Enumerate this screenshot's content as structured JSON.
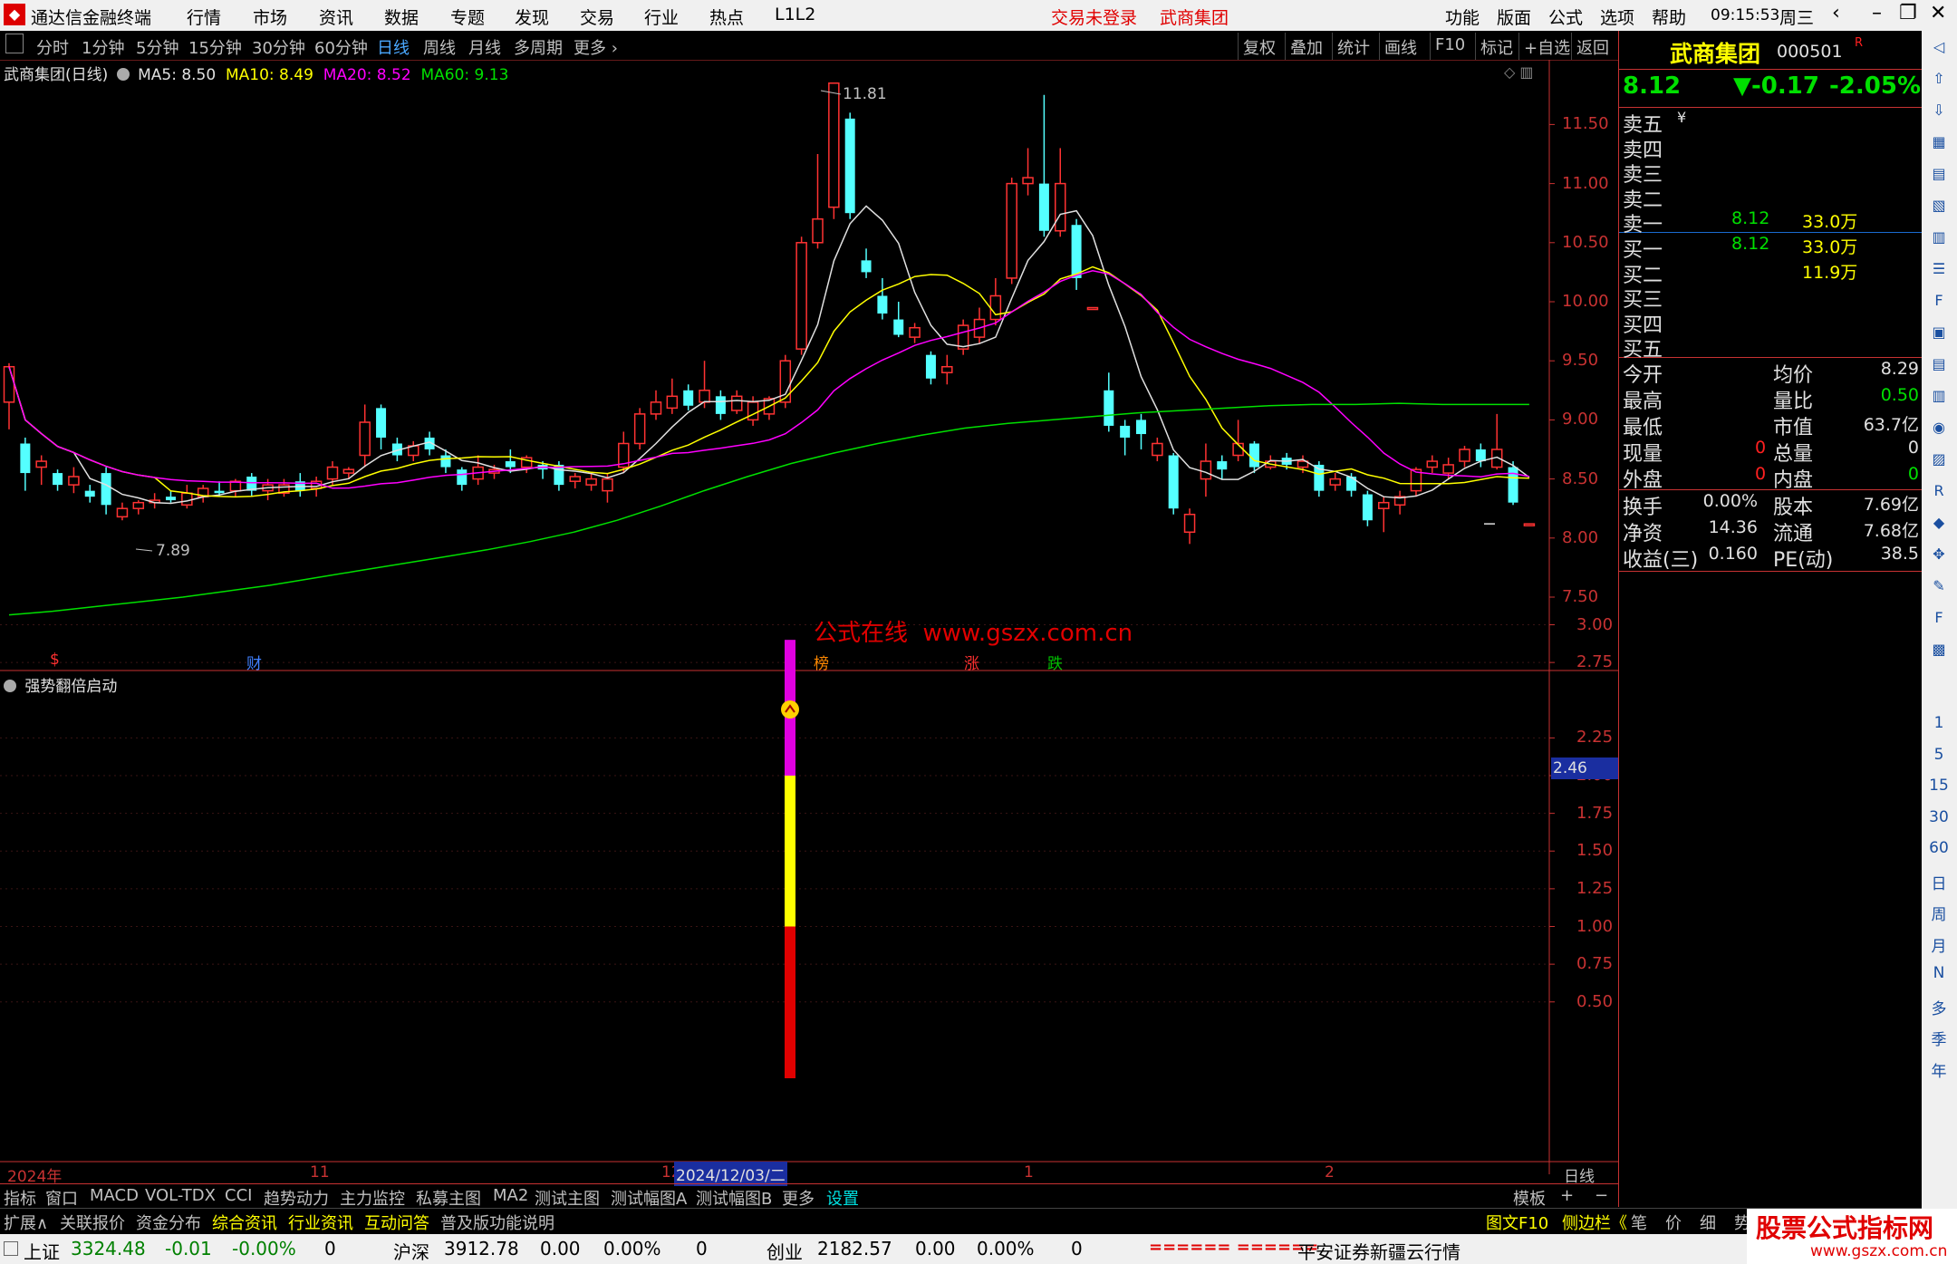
{
  "app": {
    "title": "通达信金融终端",
    "menus": [
      "行情",
      "市场",
      "资讯",
      "数据",
      "专题",
      "发现",
      "交易",
      "行业",
      "热点",
      "L1L2"
    ],
    "login_status": "交易未登录",
    "stock_name_top": "武商集团",
    "right_menus": [
      "功能",
      "版面",
      "公式",
      "选项",
      "帮助"
    ],
    "time": "09:15:53",
    "weekday": "周三"
  },
  "toolbar": {
    "periods": [
      "分时",
      "1分钟",
      "5分钟",
      "15分钟",
      "30分钟",
      "60分钟",
      "日线",
      "周线",
      "月线",
      "多周期",
      "更多 ›"
    ],
    "active_period": "日线",
    "actions": [
      "复权",
      "叠加",
      "统计",
      "画线",
      "F10",
      "标记",
      "+自选",
      "返回"
    ]
  },
  "main_chart": {
    "title": "武商集团(日线)",
    "ma": [
      {
        "label": "MA5: 8.50",
        "color": "#e0e0e0"
      },
      {
        "label": "MA10: 8.49",
        "color": "#ffff00"
      },
      {
        "label": "MA20: 8.52",
        "color": "#ff00ff"
      },
      {
        "label": "MA60: 9.13",
        "color": "#00e000"
      }
    ],
    "price_ticks": [
      "11.50",
      "11.00",
      "10.50",
      "10.00",
      "9.50",
      "9.00",
      "8.50",
      "8.00",
      "7.50"
    ],
    "high_label": "11.81",
    "low_label": "7.89",
    "watermark": "公式在线  www.gszx.com.cn",
    "event_markers": [
      {
        "text": "$",
        "color": "#ff3030"
      },
      {
        "text": "财",
        "color": "#4080ff"
      },
      {
        "text": "榜",
        "color": "#ff8800"
      },
      {
        "text": "涨",
        "color": "#ff3030"
      },
      {
        "text": "跌",
        "color": "#00c000"
      }
    ],
    "last_dash": "—"
  },
  "sub_chart": {
    "title": "强势翻倍启动",
    "ticks": [
      "3.00",
      "2.75",
      "2.25",
      "2.00",
      "1.75",
      "1.50",
      "1.25",
      "1.00",
      "0.75",
      "0.50"
    ],
    "current_value": "2.46",
    "bar": {
      "segments": [
        {
          "from": 0,
          "to": 1.0,
          "color": "#e00000"
        },
        {
          "from": 1.0,
          "to": 2.0,
          "color": "#ffff00"
        },
        {
          "from": 2.0,
          "to": 2.9,
          "color": "#e000e0"
        }
      ]
    }
  },
  "time_axis": {
    "labels": [
      "2024年",
      "11",
      "12",
      "2024/12/03/二",
      "1",
      "2"
    ],
    "right": "日线"
  },
  "chart_data": {
    "type": "candlestick",
    "ylim": [
      7.1,
      11.95
    ],
    "candles": [
      [
        9.15,
        9.45,
        9.48,
        8.92
      ],
      [
        8.8,
        8.55,
        8.85,
        8.4
      ],
      [
        8.6,
        8.65,
        8.7,
        8.45
      ],
      [
        8.55,
        8.45,
        8.58,
        8.4
      ],
      [
        8.45,
        8.52,
        8.6,
        8.38
      ],
      [
        8.4,
        8.35,
        8.45,
        8.3
      ],
      [
        8.55,
        8.28,
        8.6,
        8.2
      ],
      [
        8.18,
        8.25,
        8.3,
        8.15
      ],
      [
        8.25,
        8.3,
        8.32,
        8.2
      ],
      [
        8.3,
        8.32,
        8.38,
        8.25
      ],
      [
        8.35,
        8.32,
        8.4,
        8.3
      ],
      [
        8.28,
        8.38,
        8.45,
        8.25
      ],
      [
        8.35,
        8.42,
        8.45,
        8.3
      ],
      [
        8.4,
        8.38,
        8.48,
        8.35
      ],
      [
        8.4,
        8.48,
        8.5,
        8.35
      ],
      [
        8.52,
        8.4,
        8.55,
        8.35
      ],
      [
        8.4,
        8.45,
        8.5,
        8.32
      ],
      [
        8.38,
        8.45,
        8.5,
        8.35
      ],
      [
        8.48,
        8.4,
        8.55,
        8.35
      ],
      [
        8.42,
        8.48,
        8.52,
        8.35
      ],
      [
        8.5,
        8.6,
        8.65,
        8.45
      ],
      [
        8.55,
        8.58,
        8.6,
        8.5
      ],
      [
        8.7,
        8.98,
        9.13,
        8.6
      ],
      [
        9.1,
        8.85,
        9.13,
        8.75
      ],
      [
        8.8,
        8.7,
        8.85,
        8.65
      ],
      [
        8.7,
        8.78,
        8.82,
        8.65
      ],
      [
        8.85,
        8.75,
        8.9,
        8.7
      ],
      [
        8.7,
        8.6,
        8.75,
        8.55
      ],
      [
        8.58,
        8.45,
        8.6,
        8.4
      ],
      [
        8.5,
        8.6,
        8.7,
        8.45
      ],
      [
        8.55,
        8.58,
        8.62,
        8.5
      ],
      [
        8.65,
        8.6,
        8.75,
        8.55
      ],
      [
        8.6,
        8.68,
        8.7,
        8.55
      ],
      [
        8.62,
        8.58,
        8.65,
        8.5
      ],
      [
        8.62,
        8.45,
        8.65,
        8.4
      ],
      [
        8.48,
        8.52,
        8.55,
        8.42
      ],
      [
        8.45,
        8.5,
        8.55,
        8.4
      ],
      [
        8.4,
        8.5,
        8.55,
        8.3
      ],
      [
        8.6,
        8.8,
        8.9,
        8.55
      ],
      [
        8.8,
        9.05,
        9.1,
        8.75
      ],
      [
        9.05,
        9.15,
        9.25,
        9.0
      ],
      [
        9.1,
        9.2,
        9.35,
        9.05
      ],
      [
        9.25,
        9.12,
        9.3,
        9.08
      ],
      [
        9.15,
        9.25,
        9.5,
        9.1
      ],
      [
        9.2,
        9.05,
        9.25,
        9.0
      ],
      [
        9.08,
        9.2,
        9.25,
        9.05
      ],
      [
        9.0,
        9.15,
        9.2,
        8.95
      ],
      [
        9.05,
        9.18,
        9.2,
        9.0
      ],
      [
        9.15,
        9.5,
        9.55,
        9.1
      ],
      [
        9.6,
        10.5,
        10.55,
        9.55
      ],
      [
        10.5,
        10.7,
        11.25,
        10.45
      ],
      [
        10.8,
        11.85,
        11.85,
        10.7
      ],
      [
        11.55,
        10.75,
        11.6,
        10.7
      ],
      [
        10.35,
        10.25,
        10.45,
        10.2
      ],
      [
        10.05,
        9.9,
        10.2,
        9.85
      ],
      [
        9.85,
        9.72,
        10.0,
        9.7
      ],
      [
        9.7,
        9.78,
        9.82,
        9.65
      ],
      [
        9.55,
        9.35,
        9.58,
        9.3
      ],
      [
        9.4,
        9.45,
        9.55,
        9.3
      ],
      [
        9.6,
        9.8,
        9.85,
        9.55
      ],
      [
        9.7,
        9.85,
        9.95,
        9.65
      ],
      [
        9.85,
        10.05,
        10.2,
        9.8
      ],
      [
        10.2,
        11.0,
        11.05,
        10.15
      ],
      [
        11.0,
        11.05,
        11.3,
        10.9
      ],
      [
        11.0,
        10.6,
        11.75,
        10.55
      ],
      [
        10.6,
        11.0,
        11.3,
        10.55
      ],
      [
        10.65,
        10.2,
        10.7,
        10.1
      ],
      [
        9.95,
        9.95,
        9.95,
        9.95
      ],
      [
        9.25,
        8.95,
        9.4,
        8.9
      ],
      [
        8.95,
        8.85,
        9.0,
        8.7
      ],
      [
        9.0,
        8.88,
        9.05,
        8.75
      ],
      [
        8.7,
        8.8,
        8.85,
        8.65
      ],
      [
        8.7,
        8.25,
        8.72,
        8.2
      ],
      [
        8.05,
        8.2,
        8.25,
        7.95
      ],
      [
        8.5,
        8.65,
        8.8,
        8.35
      ],
      [
        8.65,
        8.58,
        8.7,
        8.5
      ],
      [
        8.7,
        8.8,
        9.0,
        8.65
      ],
      [
        8.8,
        8.6,
        8.82,
        8.55
      ],
      [
        8.6,
        8.65,
        8.7,
        8.58
      ],
      [
        8.68,
        8.62,
        8.72,
        8.58
      ],
      [
        8.6,
        8.65,
        8.7,
        8.55
      ],
      [
        8.62,
        8.4,
        8.65,
        8.35
      ],
      [
        8.45,
        8.5,
        8.55,
        8.4
      ],
      [
        8.52,
        8.4,
        8.55,
        8.35
      ],
      [
        8.37,
        8.15,
        8.4,
        8.1
      ],
      [
        8.25,
        8.3,
        8.35,
        8.05
      ],
      [
        8.28,
        8.35,
        8.4,
        8.2
      ],
      [
        8.4,
        8.58,
        8.6,
        8.35
      ],
      [
        8.6,
        8.65,
        8.7,
        8.55
      ],
      [
        8.55,
        8.62,
        8.68,
        8.5
      ],
      [
        8.65,
        8.75,
        8.78,
        8.6
      ],
      [
        8.75,
        8.65,
        8.8,
        8.6
      ],
      [
        8.6,
        8.75,
        9.05,
        8.58
      ],
      [
        8.6,
        8.3,
        8.65,
        8.28
      ],
      [
        8.12,
        8.12,
        8.12,
        8.12
      ]
    ]
  },
  "indicator_tabs": [
    "指标",
    "窗口",
    "MACD",
    "VOL-TDX",
    "CCI",
    "趋势动力",
    "主力监控",
    "私募主图",
    "MA2",
    "测试主图",
    "测试幅图A",
    "测试幅图B",
    "更多",
    "设置"
  ],
  "indicator_right": [
    "模板",
    "+",
    "−"
  ],
  "info_tabs": [
    "扩展∧",
    "关联报价",
    "资金分布",
    "综合资讯",
    "行业资讯",
    "互动问答",
    "普及版功能说明"
  ],
  "info_right": [
    "图文F10",
    "侧边栏《",
    "笔",
    "价",
    "细",
    "势"
  ],
  "quote_panel": {
    "name": "武商集团",
    "code": "000501",
    "badge": "R",
    "price": "8.12",
    "change": "▼-0.17",
    "change_pct": "-2.05%",
    "asks": [
      {
        "label": "卖五",
        "price": "",
        "vol": "",
        "extra": "¥"
      },
      {
        "label": "卖四",
        "price": "",
        "vol": ""
      },
      {
        "label": "卖三",
        "price": "",
        "vol": ""
      },
      {
        "label": "卖二",
        "price": "",
        "vol": ""
      },
      {
        "label": "卖一",
        "price": "8.12",
        "vol": "33.0万"
      }
    ],
    "bids": [
      {
        "label": "买一",
        "price": "8.12",
        "vol": "33.0万"
      },
      {
        "label": "买二",
        "price": "",
        "vol": "11.9万"
      },
      {
        "label": "买三",
        "price": "",
        "vol": ""
      },
      {
        "label": "买四",
        "price": "",
        "vol": ""
      },
      {
        "label": "买五",
        "price": "",
        "vol": ""
      }
    ],
    "stats": [
      {
        "l1": "今开",
        "v1": "",
        "l2": "均价",
        "v2": "8.29",
        "c2": "#e0e0e0"
      },
      {
        "l1": "最高",
        "v1": "",
        "l2": "量比",
        "v2": "0.50",
        "c2": "#00e000"
      },
      {
        "l1": "最低",
        "v1": "",
        "l2": "市值",
        "v2": "63.7亿",
        "c2": "#e0e0e0"
      },
      {
        "l1": "现量",
        "v1": "0",
        "c1": "#ff2020",
        "l2": "总量",
        "v2": "0",
        "c2": "#e0e0e0"
      },
      {
        "l1": "外盘",
        "v1": "0",
        "c1": "#ff2020",
        "l2": "内盘",
        "v2": "0",
        "c2": "#00e000"
      }
    ],
    "stats2": [
      {
        "l1": "换手",
        "v1": "0.00%",
        "l2": "股本",
        "v2": "7.69亿"
      },
      {
        "l1": "净资",
        "v1": "14.36",
        "l2": "流通",
        "v2": "7.68亿"
      },
      {
        "l1": "收益(三)",
        "v1": "0.160",
        "l2": "PE(动)",
        "v2": "38.5"
      }
    ]
  },
  "sidebar_icons": [
    "collapse-icon",
    "up-icon",
    "down-icon",
    "chart-icon",
    "grid-icon",
    "line-icon",
    "kline-icon",
    "list-icon",
    "f10-icon",
    "book-icon",
    "news-icon",
    "fs-icon",
    "circle-icon",
    "signal-icon",
    "rsi-icon",
    "hot-icon",
    "move-icon",
    "pen-icon",
    "f5-icon",
    "switch-icon"
  ],
  "sidebar_periods": [
    "1",
    "5",
    "15",
    "30",
    "60",
    "日",
    "周",
    "月",
    "N",
    "多",
    "季",
    "年"
  ],
  "status_bar": {
    "indices": [
      {
        "name": "上证",
        "value": "3324.48",
        "chg": "-0.01",
        "pct": "-0.00%",
        "vol": "0"
      },
      {
        "name": "沪深",
        "value": "3912.78",
        "chg": "0.00",
        "pct": "0.00%",
        "vol": "0"
      },
      {
        "name": "创业",
        "value": "2182.57",
        "chg": "0.00",
        "pct": "0.00%",
        "vol": "0"
      }
    ],
    "signal": "====== ======",
    "server": "平安证券新疆云行情"
  },
  "brand": {
    "title": "股票公式指标网",
    "url": "www.gszx.com.cn"
  }
}
